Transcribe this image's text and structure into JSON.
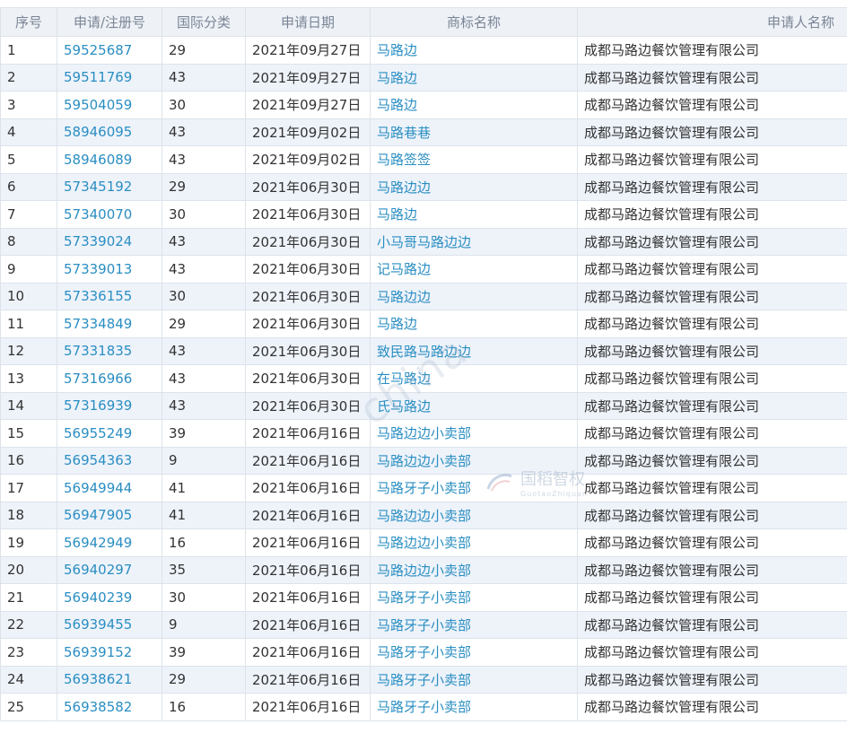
{
  "table": {
    "headers": {
      "seq": "序号",
      "reg_no": "申请/注册号",
      "intl_class": "国际分类",
      "date": "申请日期",
      "mark": "商标名称",
      "applicant": "申请人名称"
    },
    "rows": [
      {
        "seq": "1",
        "reg_no": "59525687",
        "intl_class": "29",
        "date": "2021年09月27日",
        "mark": "马路边",
        "applicant": "成都马路边餐饮管理有限公司"
      },
      {
        "seq": "2",
        "reg_no": "59511769",
        "intl_class": "43",
        "date": "2021年09月27日",
        "mark": "马路边",
        "applicant": "成都马路边餐饮管理有限公司"
      },
      {
        "seq": "3",
        "reg_no": "59504059",
        "intl_class": "30",
        "date": "2021年09月27日",
        "mark": "马路边",
        "applicant": "成都马路边餐饮管理有限公司"
      },
      {
        "seq": "4",
        "reg_no": "58946095",
        "intl_class": "43",
        "date": "2021年09月02日",
        "mark": "马路巷巷",
        "applicant": "成都马路边餐饮管理有限公司"
      },
      {
        "seq": "5",
        "reg_no": "58946089",
        "intl_class": "43",
        "date": "2021年09月02日",
        "mark": "马路签签",
        "applicant": "成都马路边餐饮管理有限公司"
      },
      {
        "seq": "6",
        "reg_no": "57345192",
        "intl_class": "29",
        "date": "2021年06月30日",
        "mark": "马路边边",
        "applicant": "成都马路边餐饮管理有限公司"
      },
      {
        "seq": "7",
        "reg_no": "57340070",
        "intl_class": "30",
        "date": "2021年06月30日",
        "mark": "马路边",
        "applicant": "成都马路边餐饮管理有限公司"
      },
      {
        "seq": "8",
        "reg_no": "57339024",
        "intl_class": "43",
        "date": "2021年06月30日",
        "mark": "小马哥马路边边",
        "applicant": "成都马路边餐饮管理有限公司"
      },
      {
        "seq": "9",
        "reg_no": "57339013",
        "intl_class": "43",
        "date": "2021年06月30日",
        "mark": "记马路边",
        "applicant": "成都马路边餐饮管理有限公司"
      },
      {
        "seq": "10",
        "reg_no": "57336155",
        "intl_class": "30",
        "date": "2021年06月30日",
        "mark": "马路边边",
        "applicant": "成都马路边餐饮管理有限公司"
      },
      {
        "seq": "11",
        "reg_no": "57334849",
        "intl_class": "29",
        "date": "2021年06月30日",
        "mark": "马路边",
        "applicant": "成都马路边餐饮管理有限公司"
      },
      {
        "seq": "12",
        "reg_no": "57331835",
        "intl_class": "43",
        "date": "2021年06月30日",
        "mark": "致民路马路边边",
        "applicant": "成都马路边餐饮管理有限公司"
      },
      {
        "seq": "13",
        "reg_no": "57316966",
        "intl_class": "43",
        "date": "2021年06月30日",
        "mark": "在马路边",
        "applicant": "成都马路边餐饮管理有限公司"
      },
      {
        "seq": "14",
        "reg_no": "57316939",
        "intl_class": "43",
        "date": "2021年06月30日",
        "mark": "氏马路边",
        "applicant": "成都马路边餐饮管理有限公司"
      },
      {
        "seq": "15",
        "reg_no": "56955249",
        "intl_class": "39",
        "date": "2021年06月16日",
        "mark": "马路边边小卖部",
        "applicant": "成都马路边餐饮管理有限公司"
      },
      {
        "seq": "16",
        "reg_no": "56954363",
        "intl_class": "9",
        "date": "2021年06月16日",
        "mark": "马路边边小卖部",
        "applicant": "成都马路边餐饮管理有限公司"
      },
      {
        "seq": "17",
        "reg_no": "56949944",
        "intl_class": "41",
        "date": "2021年06月16日",
        "mark": "马路牙子小卖部",
        "applicant": "成都马路边餐饮管理有限公司"
      },
      {
        "seq": "18",
        "reg_no": "56947905",
        "intl_class": "41",
        "date": "2021年06月16日",
        "mark": "马路边边小卖部",
        "applicant": "成都马路边餐饮管理有限公司"
      },
      {
        "seq": "19",
        "reg_no": "56942949",
        "intl_class": "16",
        "date": "2021年06月16日",
        "mark": "马路边边小卖部",
        "applicant": "成都马路边餐饮管理有限公司"
      },
      {
        "seq": "20",
        "reg_no": "56940297",
        "intl_class": "35",
        "date": "2021年06月16日",
        "mark": "马路边边小卖部",
        "applicant": "成都马路边餐饮管理有限公司"
      },
      {
        "seq": "21",
        "reg_no": "56940239",
        "intl_class": "30",
        "date": "2021年06月16日",
        "mark": "马路牙子小卖部",
        "applicant": "成都马路边餐饮管理有限公司"
      },
      {
        "seq": "22",
        "reg_no": "56939455",
        "intl_class": "9",
        "date": "2021年06月16日",
        "mark": "马路牙子小卖部",
        "applicant": "成都马路边餐饮管理有限公司"
      },
      {
        "seq": "23",
        "reg_no": "56939152",
        "intl_class": "39",
        "date": "2021年06月16日",
        "mark": "马路牙子小卖部",
        "applicant": "成都马路边餐饮管理有限公司"
      },
      {
        "seq": "24",
        "reg_no": "56938621",
        "intl_class": "29",
        "date": "2021年06月16日",
        "mark": "马路牙子小卖部",
        "applicant": "成都马路边餐饮管理有限公司"
      },
      {
        "seq": "25",
        "reg_no": "56938582",
        "intl_class": "16",
        "date": "2021年06月16日",
        "mark": "马路牙子小卖部",
        "applicant": "成都马路边餐饮管理有限公司"
      }
    ]
  },
  "watermark": {
    "diagonal_text": "china",
    "logo_text": "国稻智权",
    "logo_subtext": "GuotaoZhiquan"
  },
  "colors": {
    "link": "#2a8ec2",
    "header_bg": "#eef1f6",
    "stripe_bg": "#eef3fa",
    "border": "#dde3ea"
  }
}
